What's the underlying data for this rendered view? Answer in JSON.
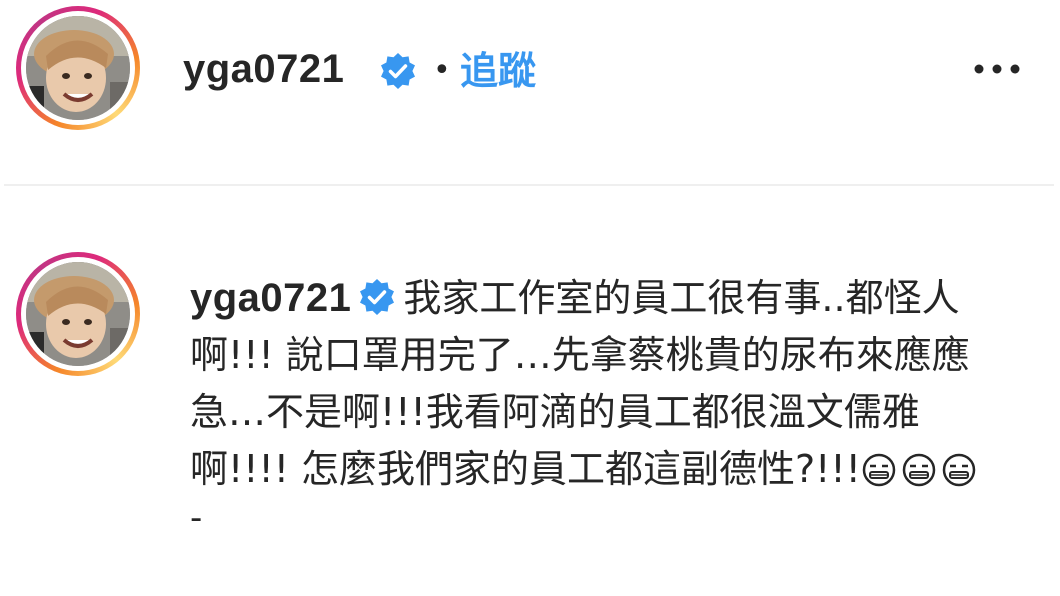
{
  "header": {
    "username": "yga0721",
    "separator": "•",
    "follow_label": "追蹤",
    "more_icon": "more-horizontal-icon",
    "avatar_icon": "profile-photo"
  },
  "comment": {
    "username": "yga0721",
    "text": "我家工作室的員工很有事..都怪人啊!!! 說口罩用完了…先拿蔡桃貴的尿布來應應急…不是啊!!!我看阿滴的員工都很溫文儒雅啊!!!! 怎麼我們家的員工都這副德性?!!!",
    "emojis": [
      "😑",
      "😑",
      "😑"
    ],
    "trailing": "-"
  },
  "colors": {
    "follow_blue": "#3897f0",
    "verified_blue": "#3897f0",
    "text": "#262626",
    "divider": "#efefef"
  }
}
